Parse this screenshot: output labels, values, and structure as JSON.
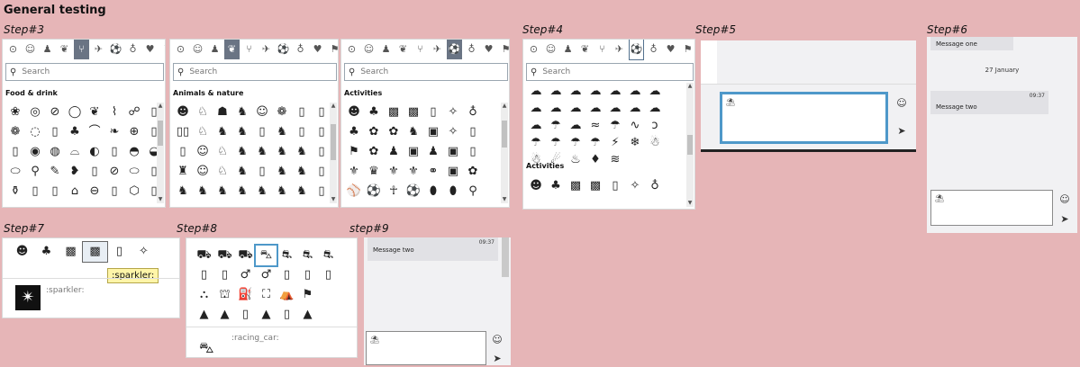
{
  "page_title": "General testing",
  "steps": [
    "Step#3",
    "Step#4",
    "Step#5",
    "Step#6",
    "Step#7",
    "Step#8",
    "step#9"
  ],
  "search_placeholder": "Search",
  "categories": {
    "food": "Food & drink",
    "animals": "Animals & nature",
    "activities": "Activities"
  },
  "step5": {
    "glyph": "⛱"
  },
  "step6": {
    "message_one": "Message one",
    "date": "27 January",
    "message_two": "Message two",
    "message_two_time": "09:37",
    "glyph": "⛱"
  },
  "step7": {
    "tooltip": ":sparkler:",
    "preview_label": ":sparkler:"
  },
  "step8": {
    "preview_label": ":racing_car:"
  },
  "step9": {
    "message": "Message two",
    "time": "09:37",
    "glyph": "⛱"
  },
  "icons": {
    "emoji": "☺",
    "send": "➤"
  }
}
